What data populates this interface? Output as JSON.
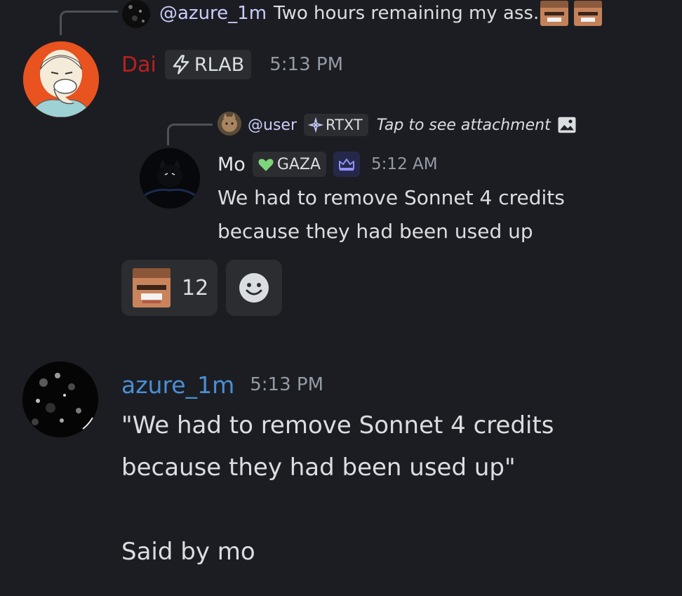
{
  "first_reply": {
    "mention": "@azure_1m",
    "text": "Two hours remaining my ass."
  },
  "dai_message": {
    "username": "Dai",
    "username_color": "#b8211f",
    "tag_label": "RLAB",
    "timestamp": "5:13 PM"
  },
  "nested_reply": {
    "mention": "@user",
    "tag_label": "RTXT",
    "text": "Tap to see attachment"
  },
  "mo_message": {
    "username": "Mo",
    "tag_label": "GAZA",
    "timestamp": "5:12 AM",
    "line1": "We had to remove Sonnet 4 credits",
    "line2": "because they had been used up"
  },
  "reactions": {
    "count": "12"
  },
  "azure_message": {
    "username": "azure_1m",
    "username_color": "#4a8fd6",
    "timestamp": "5:13 PM",
    "line1": "\"We had to remove Sonnet 4 credits",
    "line2": "because they had been used up\"",
    "line3": "Said by mo"
  },
  "icons": {
    "tag_dai": "lightning-bolt-icon",
    "tag_user": "sparkle-icon",
    "tag_mo": "green-heart-icon",
    "attachment": "image-icon",
    "crown": "crown-icon",
    "add_reaction": "smiley-icon"
  },
  "colors": {
    "background": "#1c1d22",
    "text": "#dbdee1",
    "muted": "#949ba4",
    "mention": "#c9cdfb"
  }
}
